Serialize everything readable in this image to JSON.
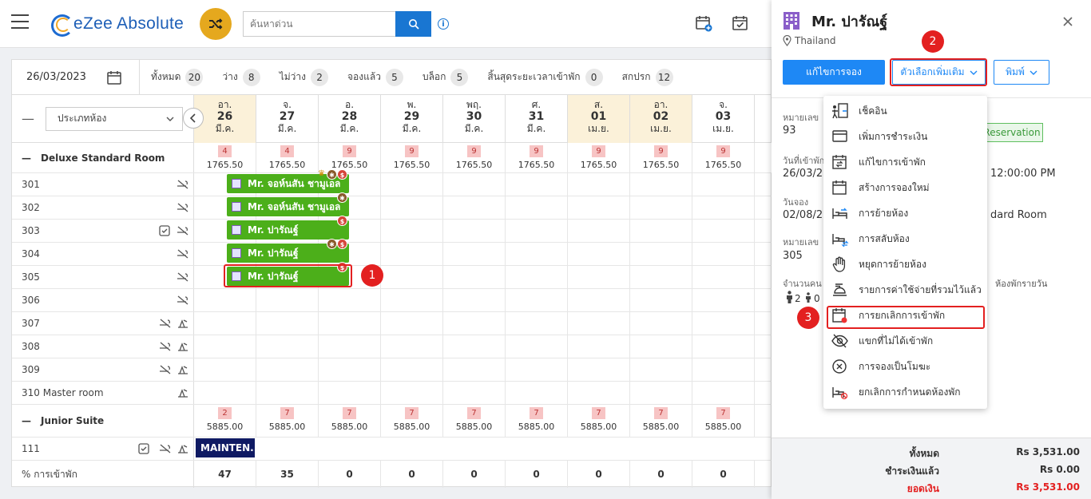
{
  "app": {
    "name": "eZee Absolute",
    "search_placeholder": "ค้นหาด่วน"
  },
  "filters": {
    "date": "26/03/2023",
    "items": [
      {
        "label": "ทั้งหมด",
        "count": "20"
      },
      {
        "label": "ว่าง",
        "count": "8"
      },
      {
        "label": "ไม่ว่าง",
        "count": "2"
      },
      {
        "label": "จองแล้ว",
        "count": "5"
      },
      {
        "label": "บล็อก",
        "count": "5"
      },
      {
        "label": "สิ้นสุดระยะเวลาเข้าพัก",
        "count": "0"
      },
      {
        "label": "สกปรก",
        "count": "12"
      }
    ]
  },
  "grid": {
    "room_type_select": "ประเภทห้อง",
    "days": [
      {
        "dow": "อา.",
        "day": "26",
        "mon": "มี.ค."
      },
      {
        "dow": "จ.",
        "day": "27",
        "mon": "มี.ค."
      },
      {
        "dow": "อ.",
        "day": "28",
        "mon": "มี.ค."
      },
      {
        "dow": "พ.",
        "day": "29",
        "mon": "มี.ค."
      },
      {
        "dow": "พฤ.",
        "day": "30",
        "mon": "มี.ค."
      },
      {
        "dow": "ศ.",
        "day": "31",
        "mon": "มี.ค."
      },
      {
        "dow": "ส.",
        "day": "01",
        "mon": "เม.ย."
      },
      {
        "dow": "อา.",
        "day": "02",
        "mon": "เม.ย."
      },
      {
        "dow": "จ.",
        "day": "03",
        "mon": "เม.ย."
      }
    ],
    "deluxe": {
      "name": "Deluxe Standard Room",
      "avail": [
        "4",
        "4",
        "9",
        "9",
        "9",
        "9",
        "9",
        "9",
        "9"
      ],
      "rate": "1765.50",
      "rooms": [
        "301",
        "302",
        "303",
        "304",
        "305",
        "306",
        "307",
        "308",
        "309",
        "310 Master room"
      ]
    },
    "junior": {
      "name": "Junior Suite",
      "avail": [
        "2",
        "7",
        "7",
        "7",
        "7",
        "7",
        "7",
        "7",
        "7"
      ],
      "rate": "5885.00",
      "rooms": [
        "111"
      ]
    },
    "bookings": [
      "Mr. จอห์นสัน ชามูเอล",
      "Mr. จอห์นสัน ชามูเอล",
      "Mr. ปารัณฐ์",
      "Mr. ปารัณฐ์",
      "Mr. ปารัณฐ์"
    ],
    "maintenance": "MAINTEN...",
    "occupancy_label": "% การเข้าพัก",
    "occupancy": [
      "47",
      "35",
      "0",
      "0",
      "0",
      "0",
      "0",
      "0",
      "0"
    ],
    "currency_mark": "$"
  },
  "drawer": {
    "guest": "Mr. ปารัณฐ์",
    "country": "Thailand",
    "btn_edit": "แก้ไขการจอง",
    "btn_more": "ตัวเลือกเพิ่มเติม",
    "btn_print": "พิมพ์",
    "res_no_label": "หมายเลข",
    "res_no": "93",
    "status": "Reservation",
    "checkin_label": "วันที่เข้าพัก",
    "checkin": "26/03/20",
    "time": "12:00:00 PM",
    "booked_label": "วันจอง",
    "booked": "02/08/20",
    "room_type": "dard Room",
    "room_no_label": "หมายเลข",
    "room_no": "305",
    "pax_label": "จำนวนคน",
    "adults": "2",
    "children": "0",
    "rate_type": "ห้องพักรายวัน",
    "menu": [
      "เช็คอิน",
      "เพิ่มการชำระเงิน",
      "แก้ไขการเข้าพัก",
      "สร้างการจองใหม่",
      "การย้ายห้อง",
      "การสลับห้อง",
      "หยุดการย้ายห้อง",
      "รายการค่าใช้จ่ายที่รวมไว้แล้ว",
      "การยกเลิกการเข้าพัก",
      "แขกที่ไม่ได้เข้าพัก",
      "การจองเป็นโมฆะ",
      "ยกเลิกการกำหนดห้องพัก"
    ],
    "totals": {
      "total_label": "ทั้งหมด",
      "total": "Rs 3,531.00",
      "paid_label": "ชำระเงินแล้ว",
      "paid": "Rs 0.00",
      "balance_label": "ยอดเงิน",
      "balance": "Rs 3,531.00"
    }
  },
  "steps": [
    "1",
    "2",
    "3"
  ],
  "colors": {
    "primary": "#1e88f5",
    "booking": "#4caf1a",
    "highlight": "#e32020",
    "weekend": "#fbf1d9"
  }
}
